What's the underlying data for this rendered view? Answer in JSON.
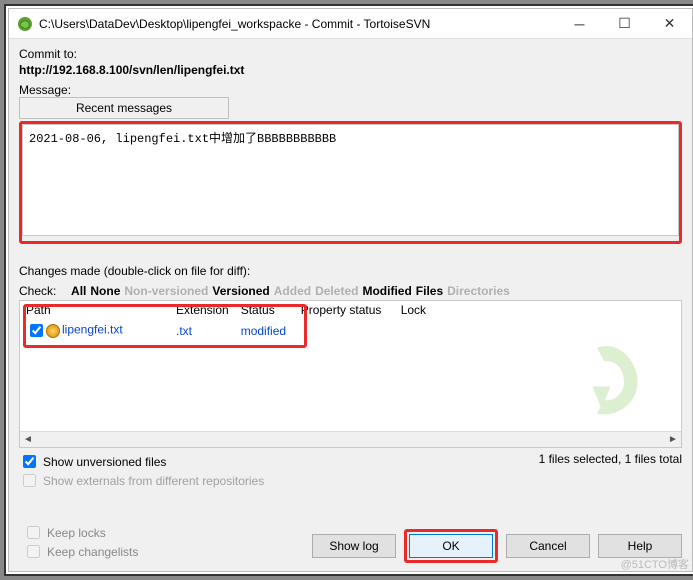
{
  "window": {
    "title": "C:\\Users\\DataDev\\Desktop\\lipengfei_workspacke - Commit - TortoiseSVN"
  },
  "commit": {
    "commit_to_label": "Commit to:",
    "url": "http://192.168.8.100/svn/len/lipengfei.txt",
    "message_label": "Message:",
    "recent_btn": "Recent messages",
    "message_text": "2021-08-06, lipengfei.txt中增加了BBBBBBBBBBB"
  },
  "changes": {
    "label": "Changes made (double-click on file for diff):",
    "check_label": "Check:",
    "filters": {
      "all": "All",
      "none": "None",
      "nonversioned": "Non-versioned",
      "versioned": "Versioned",
      "added": "Added",
      "deleted": "Deleted",
      "modified": "Modified",
      "files": "Files",
      "directories": "Directories"
    },
    "headers": {
      "path": "Path",
      "extension": "Extension",
      "status": "Status",
      "propstatus": "Property status",
      "lock": "Lock"
    },
    "rows": [
      {
        "checked": true,
        "name": "lipengfei.txt",
        "ext": ".txt",
        "status": "modified"
      }
    ]
  },
  "options": {
    "show_unversioned": "Show unversioned files",
    "show_externals": "Show externals from different repositories",
    "keep_locks": "Keep locks",
    "keep_changelists": "Keep changelists"
  },
  "status": {
    "selected": "1 files selected, 1 files total"
  },
  "buttons": {
    "showlog": "Show log",
    "ok": "OK",
    "cancel": "Cancel",
    "help": "Help"
  },
  "credit": "@51CTO博客"
}
